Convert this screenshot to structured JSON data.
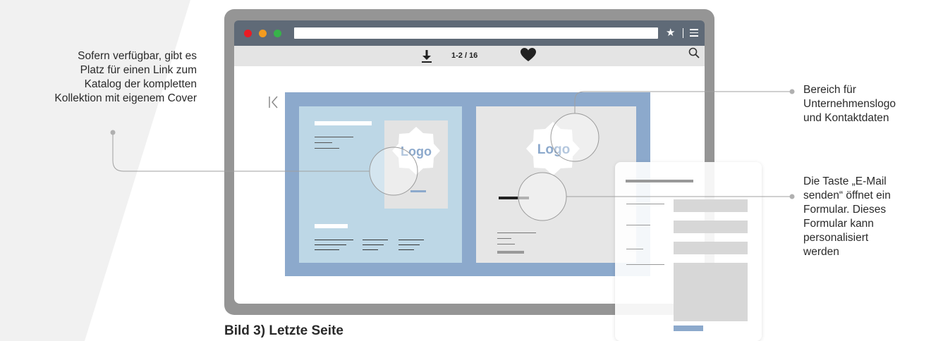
{
  "annotations": {
    "left": [
      "Sofern verfügbar, gibt es",
      "Platz für einen Link zum",
      "Katalog der kompletten",
      "Kollektion mit eigenem Cover"
    ],
    "right_top": [
      "Bereich für",
      "Unternehmenslogo",
      "und Kontaktdaten"
    ],
    "right_bottom": [
      "Die Taste „E-Mail",
      "senden“ öffnet ein",
      "Formular. Dieses",
      "Formular kann",
      "personalisiert",
      "werden"
    ]
  },
  "caption": "Bild 3) Letzte Seite",
  "viewer": {
    "page_counter": "1-2 / 16",
    "logo_left": "Logo",
    "logo_right": "Logo"
  },
  "icons": {
    "window_buttons": [
      "close-dot-icon",
      "minimize-dot-icon",
      "maximize-dot-icon"
    ],
    "address_bar": [
      "star-icon",
      "menu-icon"
    ],
    "toolbar": [
      "download-icon",
      "heart-icon",
      "search-icon"
    ],
    "navigation": [
      "first-page-icon"
    ]
  },
  "colors": {
    "frame": "#959595",
    "window_chrome": "#5f6a77",
    "toolbar": "#e4e4e4",
    "spread_background": "#8ca9cc",
    "left_page": "#bdd7e6",
    "right_page": "#e6e6e6",
    "logo_text": "#8ca9cc",
    "accent_bar": "#8ca9cc",
    "dot_red": "#ea1c24",
    "dot_orange": "#f49b1e",
    "dot_green": "#37b34a"
  }
}
